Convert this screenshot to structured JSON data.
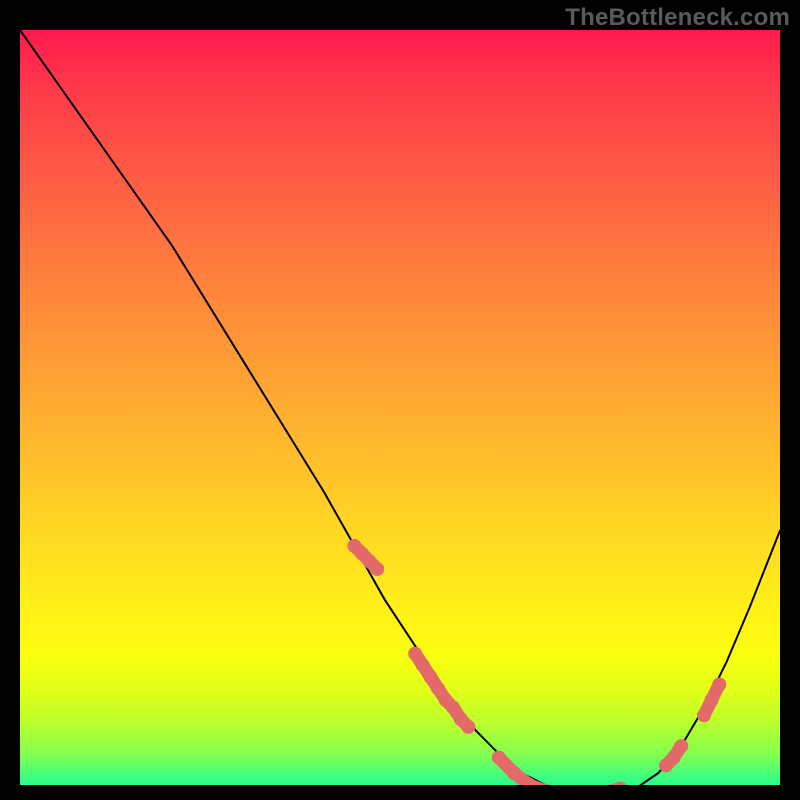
{
  "watermark": "TheBottleneck.com",
  "colors": {
    "page_bg": "#000000",
    "watermark": "#5a5a5a",
    "curve": "#000000",
    "markers": "#e46a6a",
    "gradient_top": "#ff1a4d",
    "gradient_mid": "#ffd524",
    "gradient_bottom": "#12f59f"
  },
  "chart_data": {
    "type": "line",
    "title": "",
    "xlabel": "",
    "ylabel": "",
    "xlim": [
      0,
      100
    ],
    "ylim": [
      0,
      100
    ],
    "grid": false,
    "legend": false,
    "x": [
      0,
      5,
      10,
      15,
      20,
      25,
      30,
      35,
      40,
      44,
      48,
      52,
      56,
      60,
      63,
      66,
      69,
      72,
      75,
      78,
      81,
      84,
      87,
      90,
      93,
      96,
      100
    ],
    "y": [
      100,
      93,
      86,
      79,
      72,
      64,
      56,
      48,
      40,
      33,
      26,
      20,
      14,
      9,
      6,
      3.5,
      2,
      1,
      0.5,
      0.5,
      1.5,
      3.5,
      7,
      12,
      18,
      25,
      35
    ],
    "markers": [
      {
        "cluster": "left-steep",
        "points": [
          [
            44,
            33
          ],
          [
            45,
            32
          ],
          [
            46,
            31
          ],
          [
            47,
            30
          ]
        ]
      },
      {
        "cluster": "left-mid",
        "points": [
          [
            52,
            19
          ],
          [
            53,
            17.5
          ],
          [
            54,
            16
          ],
          [
            55,
            14.5
          ],
          [
            56,
            13
          ],
          [
            57,
            12
          ],
          [
            58,
            10.5
          ],
          [
            59,
            9.5
          ]
        ]
      },
      {
        "cluster": "valley",
        "points": [
          [
            63,
            5.5
          ],
          [
            65,
            3.5
          ],
          [
            67,
            2
          ],
          [
            69,
            1.2
          ],
          [
            71,
            0.7
          ],
          [
            73,
            0.5
          ],
          [
            75,
            0.7
          ],
          [
            77,
            1
          ],
          [
            79,
            1.5
          ]
        ]
      },
      {
        "cluster": "right-mid",
        "points": [
          [
            85,
            4.5
          ],
          [
            86,
            5.5
          ],
          [
            87,
            7
          ]
        ]
      },
      {
        "cluster": "right-up",
        "points": [
          [
            90,
            11
          ],
          [
            91,
            13
          ],
          [
            92,
            15
          ]
        ]
      }
    ]
  }
}
